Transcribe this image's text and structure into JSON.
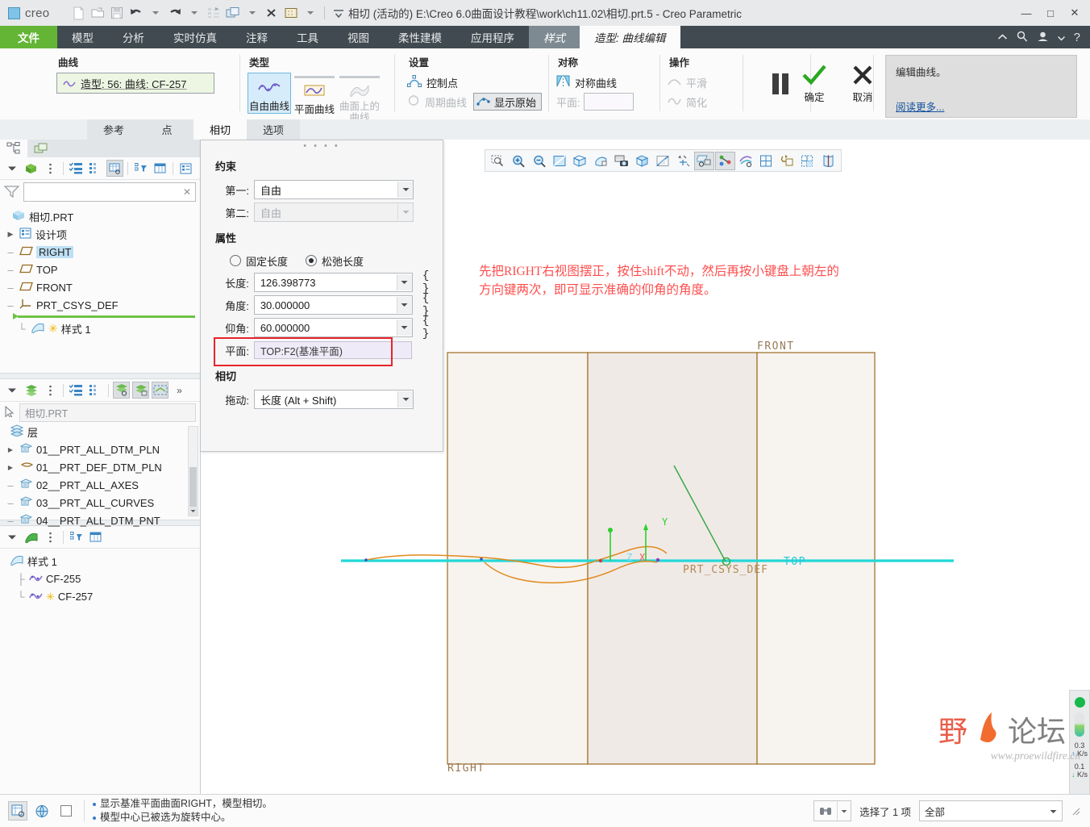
{
  "titlebar": {
    "brand": "creo",
    "title": "相切 (活动的) E:\\Creo 6.0曲面设计教程\\work\\ch11.02\\相切.prt.5 - Creo Parametric",
    "quick_access": [
      "new-file-icon",
      "open-folder-icon",
      "save-icon",
      "undo-icon",
      "undo-dropdown-icon",
      "redo-icon",
      "redo-dropdown-icon",
      "regenerate-icon",
      "window-switch-icon",
      "window-dropdown-icon",
      "close-window-icon",
      "appearance-icon",
      "appearance-dropdown-icon",
      "qat-customize-icon"
    ],
    "window_buttons": {
      "minimize": "—",
      "maximize": "□",
      "close": "✕"
    }
  },
  "ribbon_tabs": {
    "items": [
      {
        "label": "文件",
        "state": "file"
      },
      {
        "label": "模型",
        "state": "normal"
      },
      {
        "label": "分析",
        "state": "normal"
      },
      {
        "label": "实时仿真",
        "state": "normal"
      },
      {
        "label": "注释",
        "state": "normal"
      },
      {
        "label": "工具",
        "state": "normal"
      },
      {
        "label": "视图",
        "state": "normal"
      },
      {
        "label": "柔性建模",
        "state": "normal"
      },
      {
        "label": "应用程序",
        "state": "normal"
      },
      {
        "label": "样式",
        "state": "style"
      },
      {
        "label": "造型: 曲线编辑",
        "state": "active"
      }
    ],
    "right_icons": [
      "collapse-ribbon-icon",
      "search-icon",
      "account-icon",
      "account-dropdown-icon",
      "help-icon"
    ]
  },
  "ribbon": {
    "curve_group": {
      "title": "曲线",
      "selection": "造型: 56: 曲线: CF-257"
    },
    "type_group": {
      "title": "类型",
      "buttons": [
        {
          "label": "自由曲线",
          "state": "selected"
        },
        {
          "label": "平面曲线",
          "state": "normal"
        },
        {
          "label": "曲面上的曲线",
          "state": "disabled"
        }
      ]
    },
    "settings_group": {
      "title": "设置",
      "control_points": "控制点",
      "periodic_curve": "周期曲线",
      "show_original": "显示原始"
    },
    "symmetry_group": {
      "title": "对称",
      "symmetric_curve": "对称曲线",
      "plane_label": "平面:",
      "plane_value": ""
    },
    "operation_group": {
      "title": "操作",
      "smooth": "平滑",
      "simplify": "简化"
    },
    "actions": {
      "pause": "pause-icon",
      "ok": "确定",
      "cancel": "取消"
    },
    "help": {
      "text": "编辑曲线。",
      "link": "阅读更多..."
    }
  },
  "dashboard_tabs": [
    {
      "label": "参考",
      "state": "grey"
    },
    {
      "label": "点",
      "state": "grey"
    },
    {
      "label": "相切",
      "state": "selected"
    },
    {
      "label": "选项",
      "state": "grey"
    }
  ],
  "model_tree": {
    "tabs": [
      "model-tree-tab",
      "layer-tree-tab"
    ],
    "toolbar_icons": [
      "tree-collapse-icon",
      "model-display-icon",
      "tree-menu-icon",
      "show-list-icon",
      "tree-columns-icon",
      "tree-settings-icon",
      "tree-filter-icon",
      "tree-column-config-icon",
      "tree-detail-icon"
    ],
    "filter_placeholder": "",
    "root": "相切.PRT",
    "items": [
      {
        "label": "设计项",
        "icon": "design-items-icon",
        "expandable": true,
        "selected": false
      },
      {
        "label": "RIGHT",
        "icon": "datum-plane-icon",
        "expandable": false,
        "selected": true
      },
      {
        "label": "TOP",
        "icon": "datum-plane-icon",
        "expandable": false,
        "selected": false
      },
      {
        "label": "FRONT",
        "icon": "datum-plane-icon",
        "expandable": false,
        "selected": false
      },
      {
        "label": "PRT_CSYS_DEF",
        "icon": "csys-icon",
        "expandable": false,
        "selected": false
      }
    ],
    "after_insert": {
      "label": "样式 1",
      "icon": "style-feature-icon",
      "modified": true
    }
  },
  "layer_tree": {
    "toolbar_icons": [
      "layer-collapse-icon",
      "layers-icon",
      "layer-menu-icon",
      "show-list-icon",
      "layer-columns-icon",
      "layer-display-icon",
      "layer-isolate-icon",
      "layer-select-icon",
      "layer-more-icon"
    ],
    "path_value": "相切.PRT",
    "root": "层",
    "items": [
      {
        "label": "01__PRT_ALL_DTM_PLN",
        "expandable": true
      },
      {
        "label": "01__PRT_DEF_DTM_PLN",
        "expandable": true
      },
      {
        "label": "02__PRT_ALL_AXES",
        "expandable": false
      },
      {
        "label": "03__PRT_ALL_CURVES",
        "expandable": false
      },
      {
        "label": "04__PRT_ALL_DTM_PNT",
        "expandable": false
      }
    ]
  },
  "style_tree": {
    "toolbar_icons": [
      "style-collapse-icon",
      "style-feature-icon",
      "style-menu-icon",
      "style-filter-icon",
      "style-detail-icon"
    ],
    "root": "样式 1",
    "items": [
      {
        "label": "CF-255",
        "modified": false
      },
      {
        "label": "CF-257",
        "modified": true
      }
    ]
  },
  "dialog": {
    "constraint": {
      "title": "约束",
      "first_label": "第一:",
      "first_value": "自由",
      "second_label": "第二:",
      "second_value": "自由"
    },
    "properties": {
      "title": "属性",
      "fixed_length": "固定长度",
      "relaxed_length": "松弛长度",
      "selected_radio": "relaxed",
      "length_label": "长度:",
      "length_value": "126.398773",
      "angle_label": "角度:",
      "angle_value": "30.000000",
      "elevation_label": "仰角:",
      "elevation_value": "60.000000",
      "plane_label": "平面:",
      "plane_value": "TOP:F2(基准平面)",
      "brace": "{ }"
    },
    "tangency": {
      "title": "相切",
      "drag_label": "拖动:",
      "drag_value": "长度 (Alt + Shift)"
    },
    "highlight_color": "#e8232a"
  },
  "viewport": {
    "graphics_toolbar": [
      "zoom-box-icon",
      "zoom-in-icon",
      "zoom-out-icon",
      "refit-icon",
      "orient-icon",
      "saved-views-icon",
      "camera-icon",
      "display-style-icon",
      "perspective-icon",
      "datum-display-icon",
      "datum-plane-display-icon",
      "point-display-icon",
      "annotation-display-icon",
      "grid-icon",
      "section-icon",
      "layer-view-icon",
      "appearance-view-icon"
    ],
    "annotation": "先把RIGHT右视图摆正，按住shift不动，然后再按小键盘上朝左的\n方向键两次，即可显示准确的仰角的角度。",
    "annotation_color": "#ff4d4d",
    "labels": {
      "front": "FRONT",
      "right": "RIGHT",
      "top": "TOP",
      "csys": "PRT_CSYS_DEF",
      "axis_x": "X",
      "axis_y": "Y",
      "axis_z": "Z"
    },
    "network_widget": {
      "up_value": "0.3",
      "up_unit": "K/s",
      "down_value": "0.1",
      "down_unit": "K/s"
    },
    "watermark": {
      "text": "野火论坛",
      "url": "www.proewildfire.cn"
    }
  },
  "statusbar": {
    "icons": [
      "selection-filter-icon",
      "globe-icon",
      "blank-icon"
    ],
    "messages": [
      "显示基准平面曲面RIGHT，模型相切。",
      "模型中心已被选为旋转中心。"
    ],
    "find_icon": "binoculars-icon",
    "selection_text": "选择了 1 项",
    "filter_value": "全部"
  }
}
